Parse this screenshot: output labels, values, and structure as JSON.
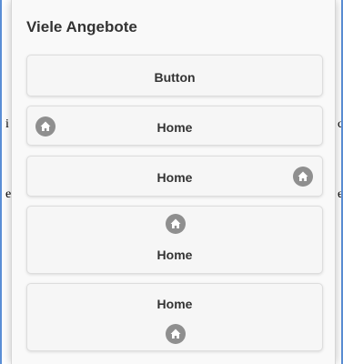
{
  "popup": {
    "title": "Viele Angebote",
    "buttons": [
      {
        "label": "Button",
        "icon": null,
        "icon_position": "none"
      },
      {
        "label": "Home",
        "icon": "home-icon",
        "icon_position": "left"
      },
      {
        "label": "Home",
        "icon": "home-icon",
        "icon_position": "right"
      },
      {
        "label": "Home",
        "icon": "home-icon",
        "icon_position": "top"
      },
      {
        "label": "Home",
        "icon": "home-icon",
        "icon_position": "bottom"
      }
    ]
  },
  "background": {
    "fragments": [
      "i",
      "e",
      "c",
      "e"
    ]
  },
  "colors": {
    "accent_edge": "#5b8fd6",
    "icon_bg": "#8f8f8f",
    "button_bg": "#f6f6f6",
    "text": "#333333"
  }
}
